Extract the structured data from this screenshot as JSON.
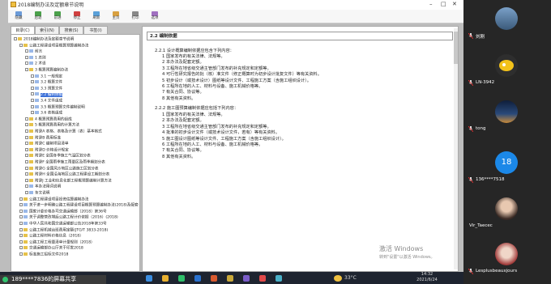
{
  "window": {
    "title": "2018编制办法及定额章节说明",
    "toolbar": [
      "隐藏",
      "后退",
      "前进",
      "停止",
      "刷新",
      "主页",
      "打印",
      "选项"
    ]
  },
  "tabs": [
    "目录(C)",
    "索引(N)",
    "搜索(S)",
    "书签(I)"
  ],
  "tree": [
    {
      "text": "2018编制办法及定额章节说明",
      "indent": 0,
      "type": "book"
    },
    {
      "text": "公路工程建设项目概算预算编制办法",
      "indent": 1,
      "type": "book"
    },
    {
      "text": "前言",
      "indent": 2,
      "type": "page"
    },
    {
      "text": "1 总则",
      "indent": 2,
      "type": "page"
    },
    {
      "text": "2 术语",
      "indent": 2,
      "type": "page"
    },
    {
      "text": "3 概算预算编制办法",
      "indent": 2,
      "type": "book"
    },
    {
      "text": "3.1 一般规定",
      "indent": 3,
      "type": "page"
    },
    {
      "text": "3.2 概算文件",
      "indent": 3,
      "type": "page"
    },
    {
      "text": "3.3 预算文件",
      "indent": 3,
      "type": "page"
    },
    {
      "text": "2.2 编制依据",
      "indent": 3,
      "type": "page",
      "selected": true
    },
    {
      "text": "3.4 文件组成",
      "indent": 3,
      "type": "page"
    },
    {
      "text": "3.5 概算预算文件编制说明",
      "indent": 3,
      "type": "page"
    },
    {
      "text": "3.6 表格组成",
      "indent": 3,
      "type": "page"
    },
    {
      "text": "4 概算预算费用的组成",
      "indent": 2,
      "type": "book"
    },
    {
      "text": "5 概算预算费用的计算方法",
      "indent": 2,
      "type": "book"
    },
    {
      "text": "附录A 表格、表格及计算（表）基本格式",
      "indent": 2,
      "type": "book"
    },
    {
      "text": "附录B 费用标准",
      "indent": 2,
      "type": "book"
    },
    {
      "text": "附录C 编制项目清单",
      "indent": 2,
      "type": "book"
    },
    {
      "text": "附录D 价格设计规定",
      "indent": 2,
      "type": "book"
    },
    {
      "text": "附录E 全国冬季施工气温区划分表",
      "indent": 2,
      "type": "book"
    },
    {
      "text": "附录F 全国雨季施工雨量区及雨季期划分表",
      "indent": 2,
      "type": "book"
    },
    {
      "text": "附录G 全国风沙地区公路施工区划分表",
      "indent": 2,
      "type": "book"
    },
    {
      "text": "附录H 全国沿海地区公路工程建设工期划分表",
      "indent": 2,
      "type": "book"
    },
    {
      "text": "附录J 工业和信息化部工程概预算编制计算方法",
      "indent": 2,
      "type": "book"
    },
    {
      "text": "本办法用词说明",
      "indent": 2,
      "type": "page"
    },
    {
      "text": "条文说明",
      "indent": 2,
      "type": "page"
    },
    {
      "text": "公路工程建设项目投资估算编制办法",
      "indent": 1,
      "type": "book"
    },
    {
      "text": "关于进一步明确公路工程建设项目概算预算编制办法(2018)及配套",
      "indent": 1,
      "type": "page"
    },
    {
      "text": "国家计委价格办司交通运输部〔2018〕第36号",
      "indent": 1,
      "type": "page"
    },
    {
      "text": "关于调整营改增后公路工程计价依据（2016）(2018)",
      "indent": 1,
      "type": "page"
    },
    {
      "text": "中华人民共和国交通运输部公告2018年第33号",
      "indent": 1,
      "type": "page"
    },
    {
      "text": "公路工程机械台班费用定额(JTG/T 3833-2018)",
      "indent": 1,
      "type": "book"
    },
    {
      "text": "公路工程材料价格信息（2018）",
      "indent": 1,
      "type": "book"
    },
    {
      "text": "公路工程工程量清单计量规则（2018）",
      "indent": 1,
      "type": "book"
    },
    {
      "text": "交通运输部办公厅关于印发2018",
      "indent": 1,
      "type": "book"
    },
    {
      "text": "标准施工招标文件2018",
      "indent": 1,
      "type": "book"
    }
  ],
  "content": {
    "section_heading": "2.2 编制依据",
    "para1_intro": "2.2.1 设计概算编制依据应包含下列内容：",
    "list1": [
      "1 国家发布的有关法律、法规等。",
      "2 本办法及配套定额。",
      "3 工程所在地省级交通主管部门发布的补充规定和定额等。",
      "4 可行性研究报告的批（核）准文件（修正概算时为初步设计批复文件）等有关资料。",
      "5 初步设计（或技术设计）图纸等设计文件、工程施工方案（含施工组织设计）。",
      "6 工程所在地的人工、材料与设备、施工机械价格等。",
      "7 有关合同、协议等。",
      "8 其他有关资料。"
    ],
    "para2_intro": "2.2.2 施工图预算编制依据应包括下列内容：",
    "list2": [
      "1 国家发布的有关法律、法规等。",
      "2 本办法及配套定额。",
      "3 工程所在地省级交通主管部门发布的补充规定和定额等。",
      "4 批准的初步设计文件（或技术设计文件，若有）等有关资料。",
      "5 施工图设计图纸等设计文件、工程施工方案（含施工组织设计）。",
      "6 工程所在地的人工、材料与设备、施工机械价格等。",
      "7 有关合同、协议等。",
      "8 其他有关资料。"
    ]
  },
  "watermark": {
    "line1": "激活 Windows",
    "line2": "转到\"设置\"以激活 Windows。"
  },
  "taskbar": {
    "share_label": "189****7836的屏幕共享",
    "weather": "33°C",
    "time": "14:32",
    "date": "2021/6/24"
  },
  "participants": [
    {
      "name": "刘刚",
      "avatar": "landscape"
    },
    {
      "name": "LN-3942",
      "avatar": "cartoon-fish"
    },
    {
      "name": "tong",
      "avatar": "bridge-night"
    },
    {
      "name": "136****7518",
      "avatar": "number",
      "number": "18"
    },
    {
      "name": "Vir_Taecec",
      "avatar": "portrait-girl"
    },
    {
      "name": "Lesplusbeauxjours",
      "avatar": "portrait-woman"
    }
  ],
  "colors": {
    "selection": "#3a6fd8",
    "participant_blue": "#1b88e8",
    "panel": "#262626"
  }
}
